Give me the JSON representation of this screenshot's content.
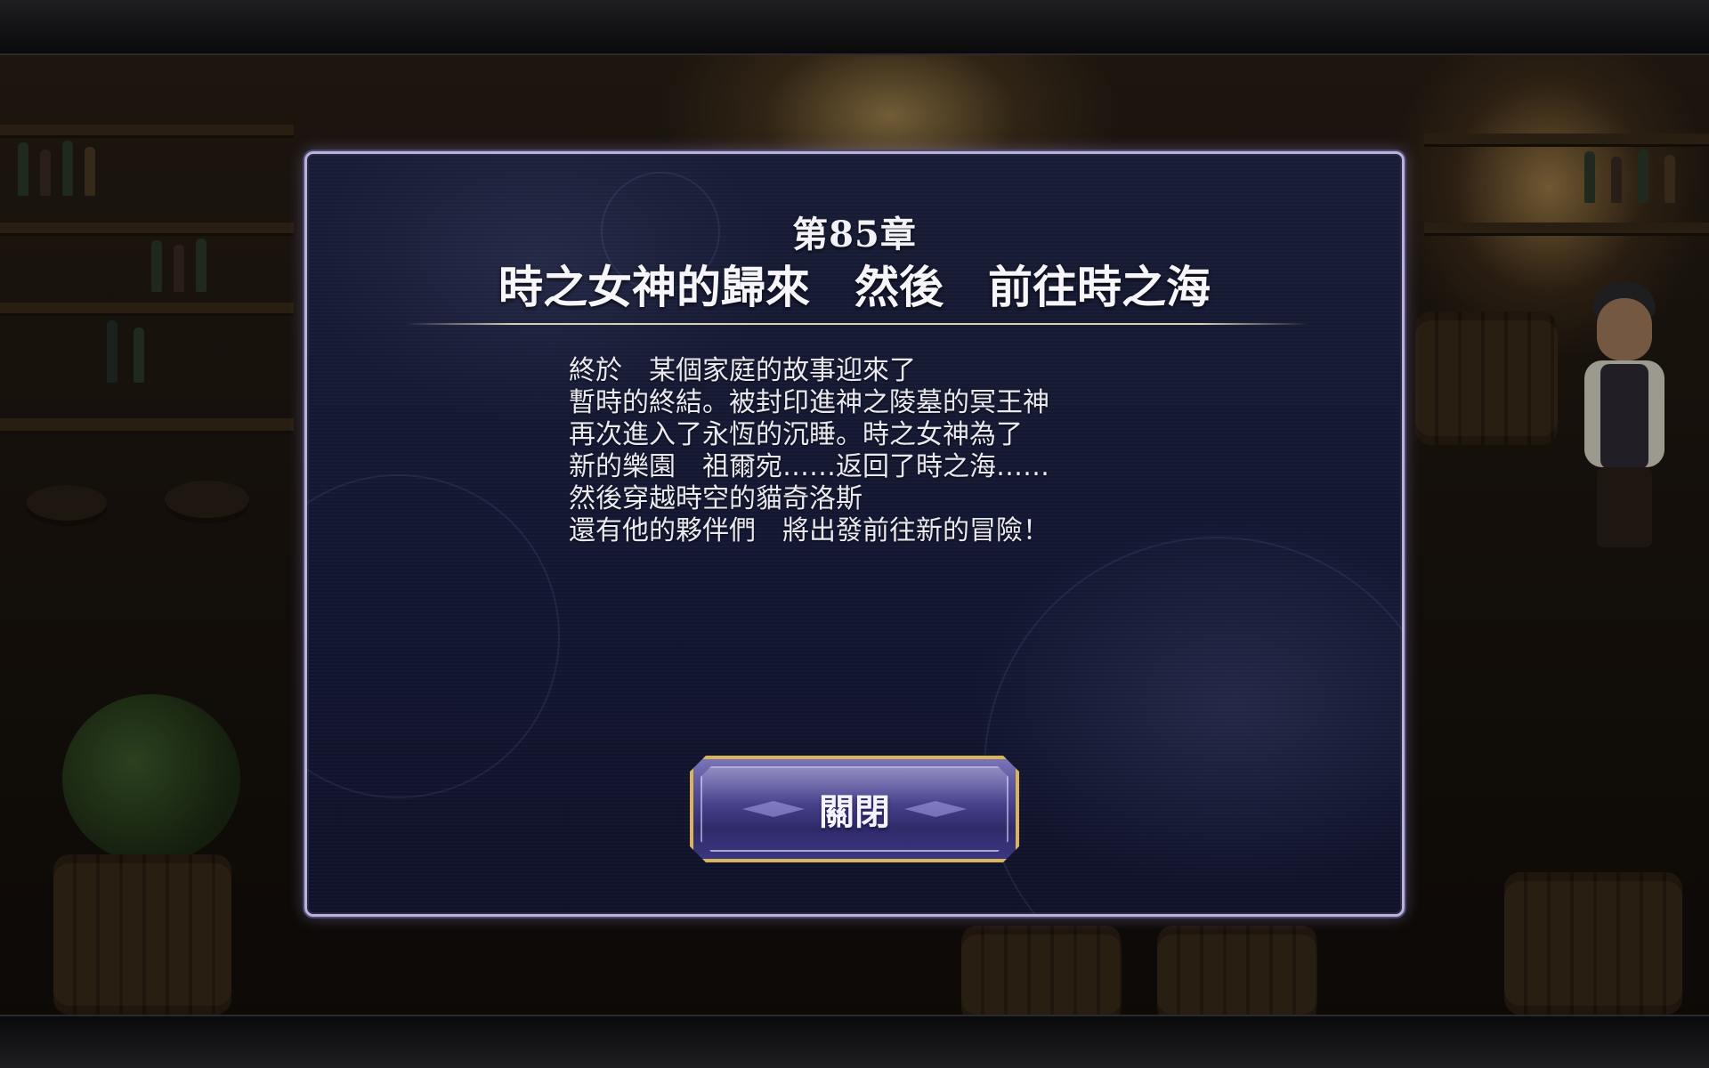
{
  "dialog": {
    "chapter_number": "第85章",
    "chapter_title": "時之女神的歸來　然後　前往時之海",
    "story_lines": [
      "終於　某個家庭的故事迎來了",
      "暫時的終結。被封印進神之陵墓的冥王神",
      "再次進入了永恆的沉睡。時之女神為了",
      "新的樂園　祖爾宛……返回了時之海……",
      "然後穿越時空的貓奇洛斯",
      "還有他的夥伴們　將出發前往新的冒險！"
    ],
    "close_label": "關閉"
  },
  "colors": {
    "dialog_border": "#b9b3d6",
    "dialog_background": "#141832",
    "button_border": "#d9b45a",
    "button_fill": "#4b4690",
    "text": "#e9e9f0"
  }
}
